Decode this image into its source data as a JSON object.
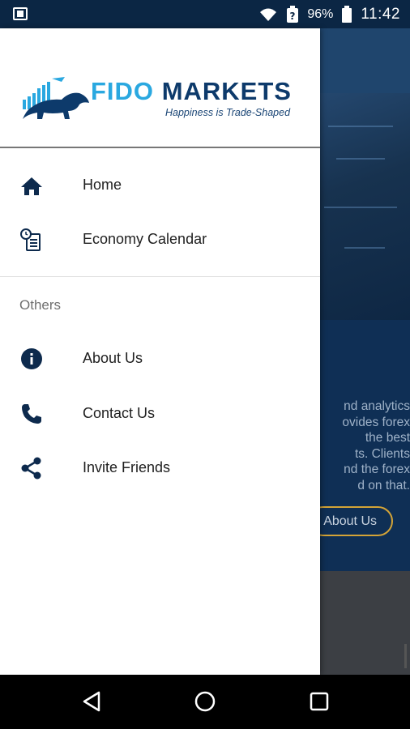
{
  "status_bar": {
    "battery_percent": "96%",
    "time": "11:42"
  },
  "logo": {
    "brand_first": "FIDO",
    "brand_second": "MARKETS",
    "tagline": "Happiness is Trade-Shaped"
  },
  "drawer": {
    "items": [
      {
        "label": "Home",
        "icon": "home-icon"
      },
      {
        "label": "Economy Calendar",
        "icon": "calendar-icon"
      }
    ],
    "section_title": "Others",
    "other_items": [
      {
        "label": "About Us",
        "icon": "info-icon"
      },
      {
        "label": "Contact Us",
        "icon": "phone-icon"
      },
      {
        "label": "Invite Friends",
        "icon": "share-icon"
      }
    ]
  },
  "background": {
    "text_lines": [
      "nd analytics",
      "ovides forex",
      "the best",
      "ts. Clients",
      "nd the forex",
      "d on that."
    ],
    "button_label": "About Us"
  },
  "colors": {
    "brand_blue": "#2aa8e0",
    "brand_navy": "#0d3a6b",
    "icon_navy": "#0d2a4d",
    "accent_gold": "#d4a437"
  }
}
